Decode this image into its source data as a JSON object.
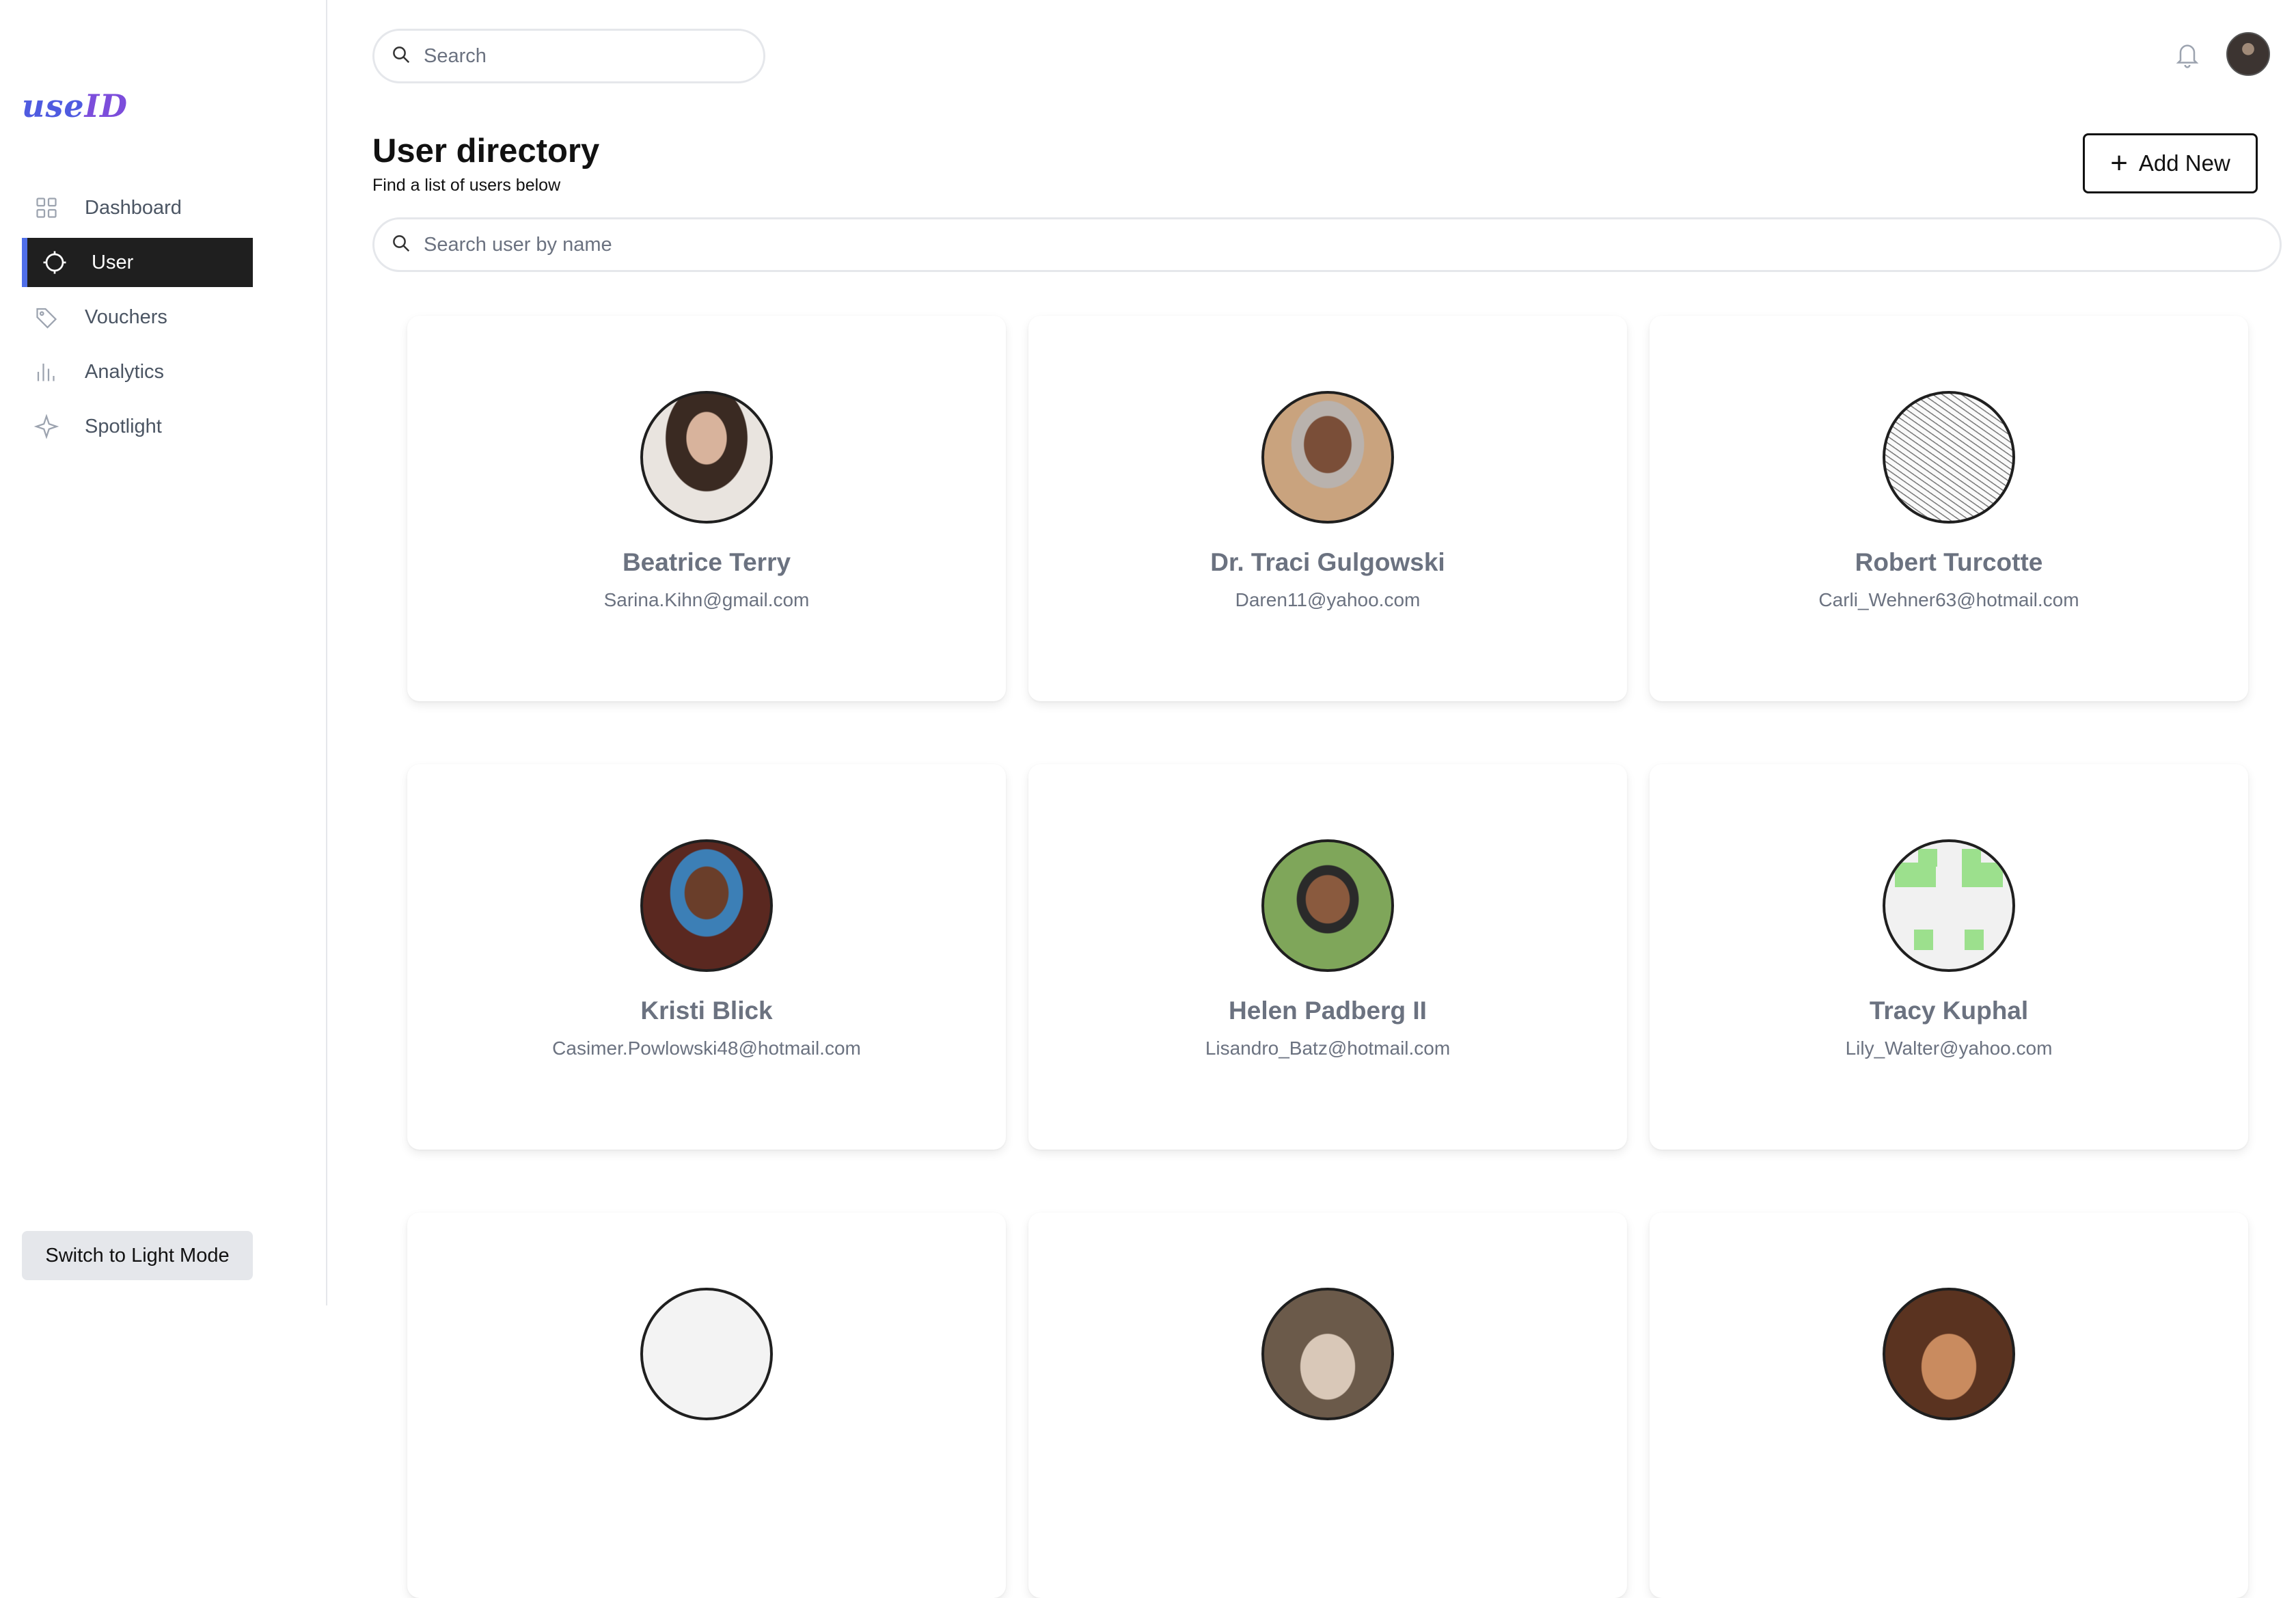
{
  "brand": {
    "logo_text_a": "use",
    "logo_text_b": "ID"
  },
  "sidebar": {
    "items": [
      {
        "label": "Dashboard",
        "icon": "grid-icon",
        "active": false
      },
      {
        "label": "User",
        "icon": "crosshair-circle-icon",
        "active": true
      },
      {
        "label": "Vouchers",
        "icon": "tag-icon",
        "active": false
      },
      {
        "label": "Analytics",
        "icon": "bar-chart-icon",
        "active": false
      },
      {
        "label": "Spotlight",
        "icon": "sparkle-icon",
        "active": false
      }
    ],
    "theme_toggle_label": "Switch to Light Mode"
  },
  "topbar": {
    "search_placeholder": "Search",
    "notification_icon": "bell-icon",
    "avatar": "profile-avatar"
  },
  "header": {
    "title": "User directory",
    "subtitle": "Find a list of users below",
    "add_button_label": "Add New"
  },
  "user_search": {
    "placeholder": "Search user by name"
  },
  "users": [
    {
      "name": "Beatrice Terry",
      "email": "Sarina.Kihn@gmail.com"
    },
    {
      "name": "Dr. Traci Gulgowski",
      "email": "Daren11@yahoo.com"
    },
    {
      "name": "Robert Turcotte",
      "email": "Carli_Wehner63@hotmail.com"
    },
    {
      "name": "Kristi Blick",
      "email": "Casimer.Powlowski48@hotmail.com"
    },
    {
      "name": "Helen Padberg II",
      "email": "Lisandro_Batz@hotmail.com"
    },
    {
      "name": "Tracy Kuphal",
      "email": "Lily_Walter@yahoo.com"
    }
  ],
  "colors": {
    "accent": "#4f6ee8",
    "active_nav_bg": "#1f1f1f",
    "logo": "#4f5be0",
    "muted_text": "#6b7280"
  }
}
